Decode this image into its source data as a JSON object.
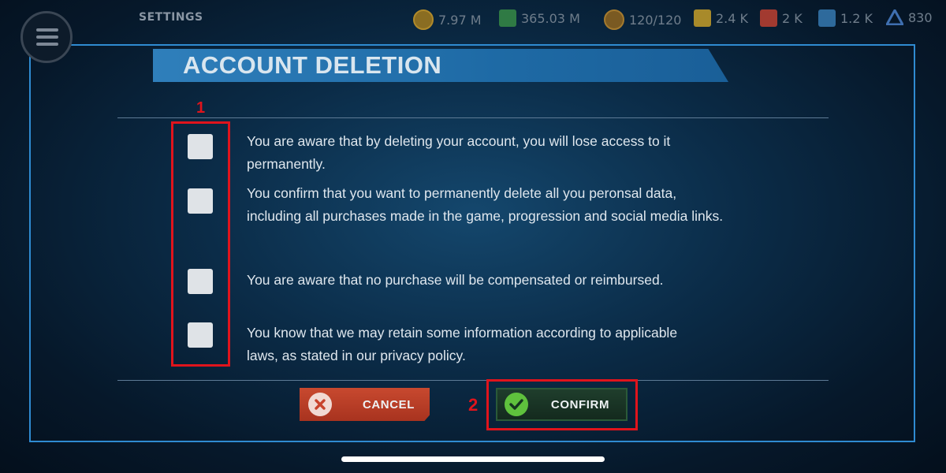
{
  "topbar": {
    "title": "SETTINGS",
    "resources": [
      {
        "icon": "gold-coin-icon",
        "value": "7.97 M",
        "color": "#c9a032"
      },
      {
        "icon": "cash-icon",
        "value": "365.03 M",
        "color": "#3fa35a"
      },
      {
        "icon": "energy-icon",
        "value": "120/120",
        "color": "#d08a2a"
      },
      {
        "icon": "yellow-crate-icon",
        "value": "2.4 K",
        "color": "#d6b13a"
      },
      {
        "icon": "red-crate-icon",
        "value": "2 K",
        "color": "#c94a3e"
      },
      {
        "icon": "blue-crate-icon",
        "value": "1.2 K",
        "color": "#3a86c4"
      },
      {
        "icon": "rank-icon",
        "value": "830",
        "color": "#4b7fc9"
      }
    ]
  },
  "dialog": {
    "title": "ACCOUNT DELETION",
    "items": [
      {
        "text": "You are aware that by deleting your account, you will lose access to it permanently.",
        "checked": false
      },
      {
        "text": "You confirm that you want to permanently delete all you peronsal data, including all purchases made in the game, progression and social media links.",
        "checked": false
      },
      {
        "text": "You are aware that no purchase will be compensated or reimbursed.",
        "checked": false
      },
      {
        "text": "You know that we may retain some information according to applicable laws, as stated in our privacy policy.",
        "checked": false
      }
    ],
    "cancel_label": "CANCEL",
    "confirm_label": "CONFIRM"
  },
  "annotations": {
    "checkboxes_number": "1",
    "confirm_number": "2",
    "color": "#e0141c"
  }
}
